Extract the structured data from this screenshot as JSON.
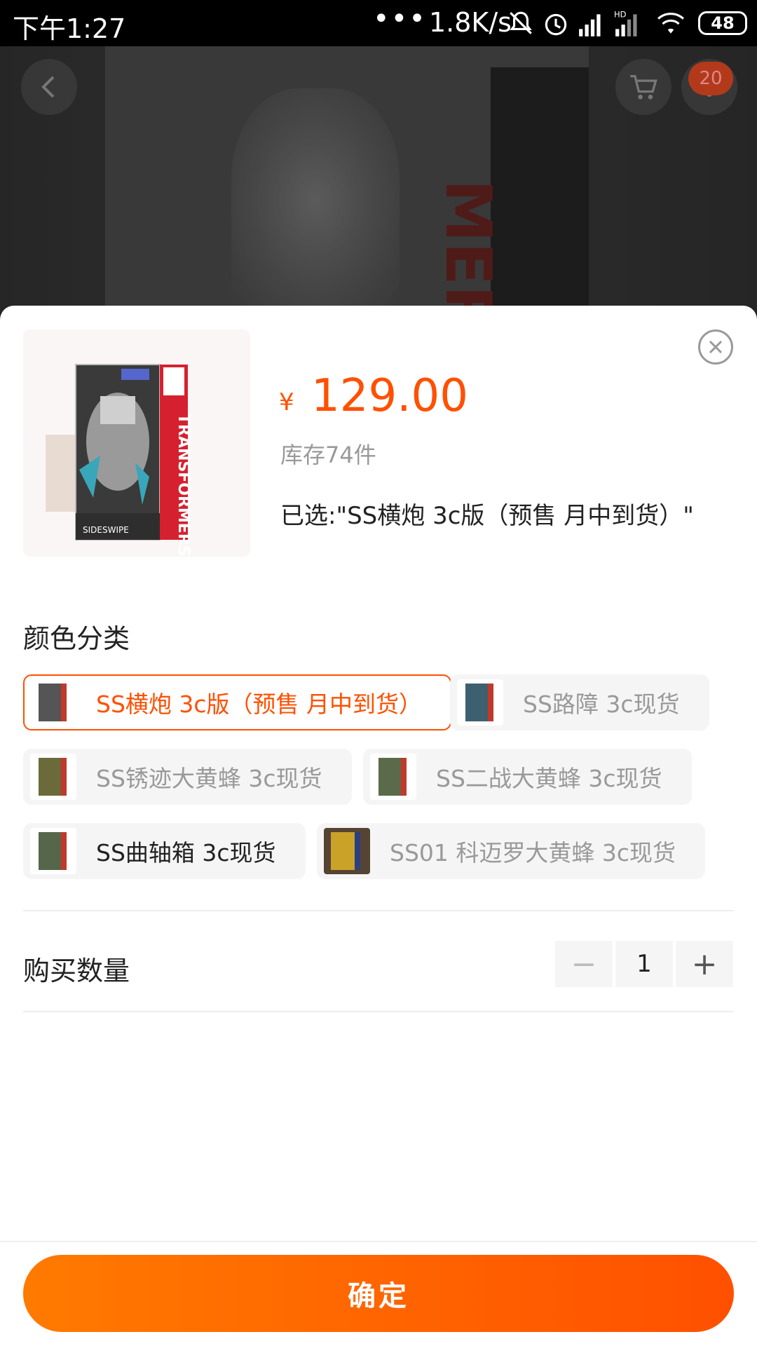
{
  "status_bar": {
    "time": "下午1:27",
    "dots": "•••",
    "speed": "1.8K/s",
    "battery": "48",
    "icons": [
      "mute-bell-icon",
      "alarm-icon",
      "signal-icon",
      "hd-signal-icon",
      "wifi-icon",
      "battery-icon"
    ]
  },
  "background": {
    "cart_badge": "20",
    "side_text": "MERS"
  },
  "sheet": {
    "price_symbol": "¥",
    "price": "129.00",
    "stock": "库存74件",
    "selected": "已选:\"SS横炮 3c版（预售 月中到货）\""
  },
  "color_section": {
    "title": "颜色分类",
    "options": [
      {
        "label": "SS横炮 3c版（预售 月中到货）",
        "state": "selected"
      },
      {
        "label": "SS路障 3c现货",
        "state": "disabled"
      },
      {
        "label": "SS锈迹大黄蜂 3c现货",
        "state": "disabled"
      },
      {
        "label": "SS二战大黄蜂 3c现货",
        "state": "disabled"
      },
      {
        "label": "SS曲轴箱 3c现货",
        "state": "available"
      },
      {
        "label": "SS01 科迈罗大黄蜂 3c现货",
        "state": "disabled"
      }
    ]
  },
  "quantity": {
    "title": "购买数量",
    "minus": "−",
    "value": "1",
    "plus": "+"
  },
  "confirm_label": "确定",
  "colors": {
    "accent": "#ff5000",
    "accent_gradient_start": "#ff7a00"
  }
}
